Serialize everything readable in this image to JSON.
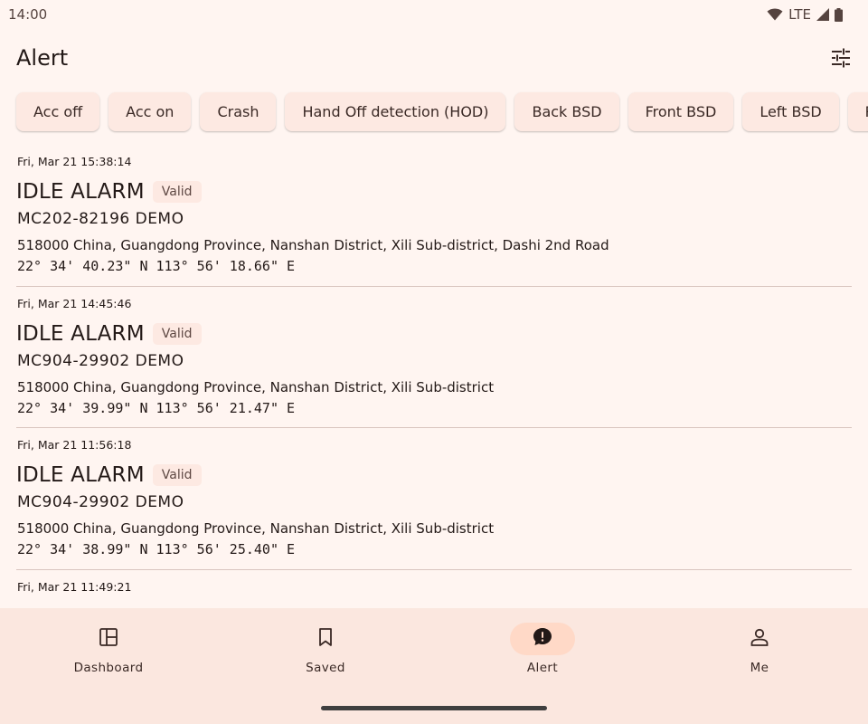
{
  "status_bar": {
    "time": "14:00",
    "network": "LTE"
  },
  "app_bar": {
    "title": "Alert",
    "filter_icon": "tune-icon"
  },
  "chips": [
    {
      "label": "Acc off"
    },
    {
      "label": "Acc on"
    },
    {
      "label": "Crash"
    },
    {
      "label": "Hand Off detection (HOD)"
    },
    {
      "label": "Back BSD"
    },
    {
      "label": "Front BSD"
    },
    {
      "label": "Left BSD"
    },
    {
      "label": "Rig"
    }
  ],
  "alerts": [
    {
      "date": "Fri, Mar 21 15:38:14",
      "type": "IDLE ALARM",
      "badge": "Valid",
      "device": "MC202-82196 DEMO",
      "address": "518000 China, Guangdong Province, Nanshan District, Xili Sub-district, Dashi 2nd Road",
      "coords": "22° 34' 40.23\" N 113° 56' 18.66\" E"
    },
    {
      "date": "Fri, Mar 21 14:45:46",
      "type": "IDLE ALARM",
      "badge": "Valid",
      "device": "MC904-29902 DEMO",
      "address": "518000 China, Guangdong Province, Nanshan District, Xili Sub-district",
      "coords": "22° 34' 39.99\" N 113° 56' 21.47\" E"
    },
    {
      "date": "Fri, Mar 21 11:56:18",
      "type": "IDLE ALARM",
      "badge": "Valid",
      "device": "MC904-29902 DEMO",
      "address": "518000 China, Guangdong Province, Nanshan District, Xili Sub-district",
      "coords": "22° 34' 38.99\" N 113° 56' 25.40\" E"
    },
    {
      "date": "Fri, Mar 21 11:49:21"
    }
  ],
  "bottom_nav": [
    {
      "label": "Dashboard",
      "icon": "dashboard-icon",
      "active": false
    },
    {
      "label": "Saved",
      "icon": "bookmark-icon",
      "active": false
    },
    {
      "label": "Alert",
      "icon": "alert-icon",
      "active": true
    },
    {
      "label": "Me",
      "icon": "person-icon",
      "active": false
    }
  ],
  "colors": {
    "background": "#fff5f1",
    "chip_bg": "#fde9e2",
    "nav_bg": "#fbe7df",
    "active_indicator": "#ffd9c7",
    "text": "#231917"
  }
}
